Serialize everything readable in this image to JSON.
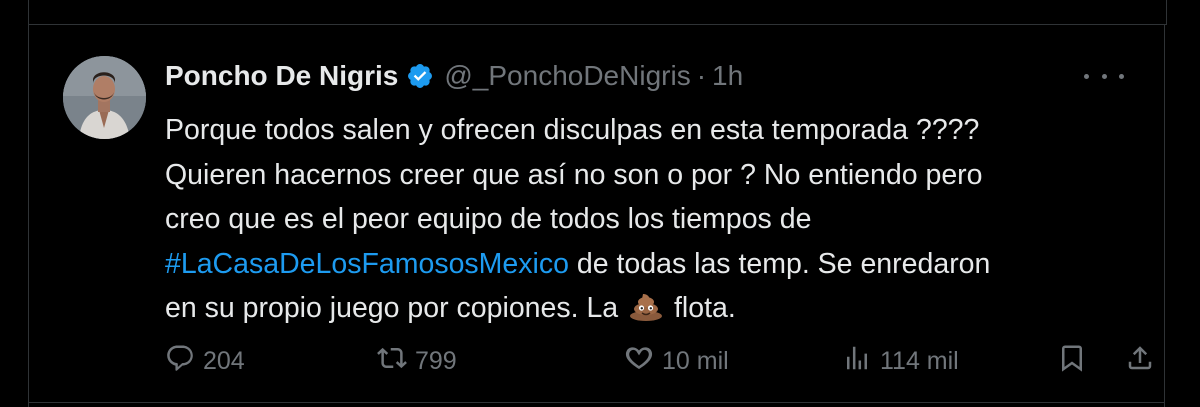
{
  "tweet": {
    "author_name": "Poncho De Nigris",
    "handle": "@_PonchoDeNigris",
    "separator": "·",
    "time": "1h",
    "text_lines": [
      "Porque todos salen y ofrecen disculpas en esta temporada ????",
      "Quieren hacernos creer que así no son o por ? No entiendo pero",
      "creo que es el peor equipo de todos los tiempos de"
    ],
    "hashtag": "#LaCasaDeLosFamososMexico",
    "line4_rest": " de todas las temp. Se enredaron",
    "line5_start": "en su propio juego por copiones. La",
    "line5_end": "flota.",
    "emoji_icon": "pile-of-poo-emoji"
  },
  "actions": {
    "replies": "204",
    "retweets": "799",
    "likes": "10 mil",
    "views": "114 mil"
  },
  "colors": {
    "background": "#000000",
    "text": "#e7e9ea",
    "muted": "#71767b",
    "accent": "#1d9bf0",
    "border": "#2f3336"
  }
}
